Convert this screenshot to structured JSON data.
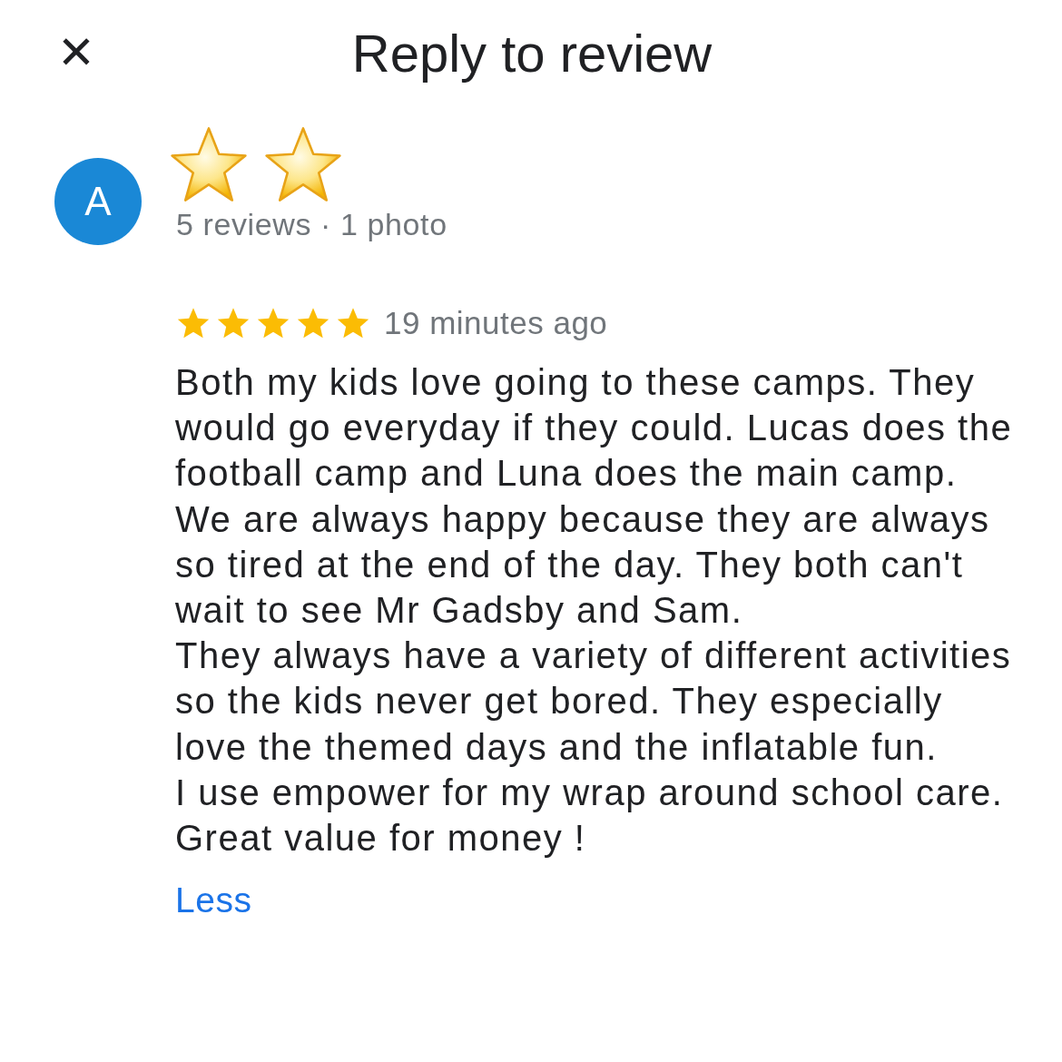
{
  "header": {
    "close_icon": "✕",
    "title": "Reply to review"
  },
  "reviewer": {
    "avatar_letter": "A",
    "stats": "5 reviews · 1 photo"
  },
  "review": {
    "stars": 5,
    "time": "19 minutes ago",
    "text": "Both my kids love going to these camps. They would go everyday if they could. Lucas does the football camp and Luna does the main camp. We are always happy because they are always so tired at the end of the day. They both can't wait to see Mr Gadsby and Sam.\nThey always have a variety of different activities so the kids never get bored. They especially love the themed days and the inflatable fun.\nI use empower for my wrap around school care. Great value for money !",
    "toggle": "Less"
  }
}
